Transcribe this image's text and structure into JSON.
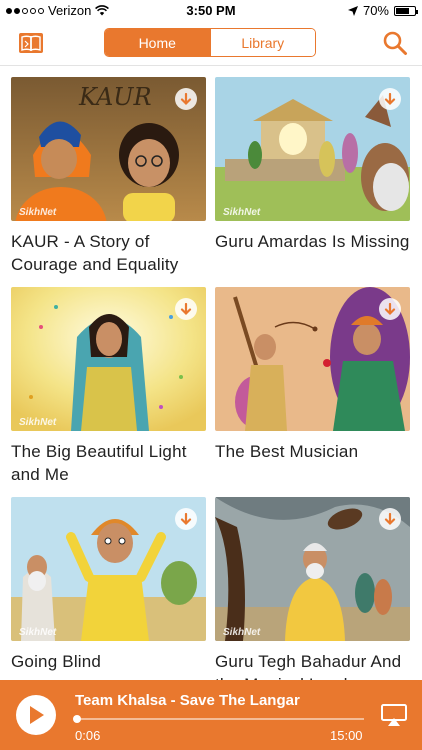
{
  "status_bar": {
    "carrier": "Verizon",
    "time": "3:50 PM",
    "battery": "70%",
    "battery_level": 0.7,
    "signal_dots_filled": 2,
    "signal_dots_total": 5
  },
  "nav": {
    "tabs": [
      {
        "label": "Home",
        "active": true
      },
      {
        "label": "Library",
        "active": false
      }
    ],
    "accent_color": "#E9782E"
  },
  "stories": [
    {
      "title": "KAUR - A Story of Courage and Equality",
      "watermark": "SikhNet",
      "icon": "download-icon"
    },
    {
      "title": "Guru Amardas Is Missing",
      "watermark": "SikhNet",
      "icon": "download-icon"
    },
    {
      "title": "The Big Beautiful Light and Me",
      "watermark": "SikhNet",
      "icon": "download-icon"
    },
    {
      "title": "The Best Musician",
      "watermark": "",
      "icon": "download-icon"
    },
    {
      "title": "Going Blind",
      "watermark": "SikhNet",
      "icon": "download-icon"
    },
    {
      "title": "Guru Tegh Bahadur And the Magical Load",
      "watermark": "SikhNet",
      "icon": "download-icon"
    }
  ],
  "player": {
    "title": "Team Khalsa - Save The Langar",
    "elapsed": "0:06",
    "total": "15:00",
    "progress": 0.007
  }
}
